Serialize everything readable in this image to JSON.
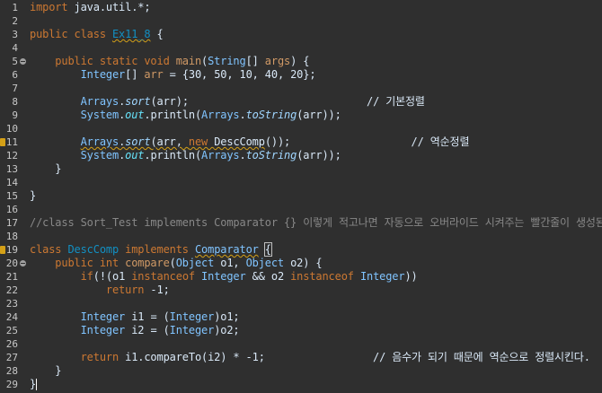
{
  "editor": {
    "lines": [
      {
        "n": "1",
        "tokens": [
          {
            "t": "import",
            "c": "kw"
          },
          {
            "t": " java.util.*;",
            "c": "plain"
          }
        ]
      },
      {
        "n": "2",
        "tokens": []
      },
      {
        "n": "3",
        "tokens": [
          {
            "t": "public class ",
            "c": "kw"
          },
          {
            "t": "Ex11_8",
            "c": "cls warn"
          },
          {
            "t": " {",
            "c": "plain"
          }
        ]
      },
      {
        "n": "4",
        "tokens": []
      },
      {
        "n": "5",
        "fold": true,
        "tokens": [
          {
            "t": "    public static void ",
            "c": "kw"
          },
          {
            "t": "main",
            "c": "fn"
          },
          {
            "t": "(",
            "c": "plain"
          },
          {
            "t": "String",
            "c": "ty"
          },
          {
            "t": "[] ",
            "c": "plain"
          },
          {
            "t": "args",
            "c": "fn"
          },
          {
            "t": ") {",
            "c": "plain"
          }
        ]
      },
      {
        "n": "6",
        "tokens": [
          {
            "t": "        ",
            "c": "plain"
          },
          {
            "t": "Integer",
            "c": "ty"
          },
          {
            "t": "[] ",
            "c": "plain"
          },
          {
            "t": "arr",
            "c": "fn"
          },
          {
            "t": " = {30, 50, 10, 40, 20};",
            "c": "plain"
          }
        ]
      },
      {
        "n": "7",
        "tokens": []
      },
      {
        "n": "8",
        "tokens": [
          {
            "t": "        ",
            "c": "plain"
          },
          {
            "t": "Arrays",
            "c": "ty"
          },
          {
            "t": ".",
            "c": "plain"
          },
          {
            "t": "sort",
            "c": "it"
          },
          {
            "t": "(arr);                            // 기본정렬",
            "c": "plain"
          }
        ]
      },
      {
        "n": "9",
        "tokens": [
          {
            "t": "        ",
            "c": "plain"
          },
          {
            "t": "System",
            "c": "ty"
          },
          {
            "t": ".",
            "c": "plain"
          },
          {
            "t": "out",
            "c": "fi"
          },
          {
            "t": ".println(",
            "c": "plain"
          },
          {
            "t": "Arrays",
            "c": "ty"
          },
          {
            "t": ".",
            "c": "plain"
          },
          {
            "t": "toString",
            "c": "it"
          },
          {
            "t": "(arr));",
            "c": "plain"
          }
        ]
      },
      {
        "n": "10",
        "tokens": []
      },
      {
        "n": "11",
        "marker": true,
        "tokens": [
          {
            "t": "        ",
            "c": "plain"
          },
          {
            "t": "Arrays",
            "c": "ty warn"
          },
          {
            "t": ".",
            "c": "plain warn"
          },
          {
            "t": "sort",
            "c": "it warn"
          },
          {
            "t": "(arr, ",
            "c": "plain warn"
          },
          {
            "t": "new ",
            "c": "kw warn"
          },
          {
            "t": "DescComp",
            "c": "plain warn"
          },
          {
            "t": "());                   // 역순정렬",
            "c": "plain"
          }
        ]
      },
      {
        "n": "12",
        "tokens": [
          {
            "t": "        ",
            "c": "plain"
          },
          {
            "t": "System",
            "c": "ty"
          },
          {
            "t": ".",
            "c": "plain"
          },
          {
            "t": "out",
            "c": "fi"
          },
          {
            "t": ".println(",
            "c": "plain"
          },
          {
            "t": "Arrays",
            "c": "ty"
          },
          {
            "t": ".",
            "c": "plain"
          },
          {
            "t": "toString",
            "c": "it"
          },
          {
            "t": "(arr));",
            "c": "plain"
          }
        ]
      },
      {
        "n": "13",
        "tokens": [
          {
            "t": "    }",
            "c": "plain"
          }
        ]
      },
      {
        "n": "14",
        "tokens": []
      },
      {
        "n": "15",
        "tokens": [
          {
            "t": "}",
            "c": "plain"
          }
        ]
      },
      {
        "n": "16",
        "tokens": []
      },
      {
        "n": "17",
        "tokens": [
          {
            "t": "//class Sort_Test implements Comparator {} 이렇게 적고나면 자동으로 오버라이드 시켜주는 빨간줄이 생성된다.",
            "c": "cm"
          }
        ]
      },
      {
        "n": "18",
        "tokens": []
      },
      {
        "n": "19",
        "marker": true,
        "tokens": [
          {
            "t": "class ",
            "c": "kw"
          },
          {
            "t": "DescComp",
            "c": "cls"
          },
          {
            "t": " implements ",
            "c": "kw"
          },
          {
            "t": "Comparator",
            "c": "ty warn"
          },
          {
            "t": " ",
            "c": "plain"
          },
          {
            "t": "{",
            "c": "plain box"
          }
        ]
      },
      {
        "n": "20",
        "fold": true,
        "tokens": [
          {
            "t": "    public int ",
            "c": "kw"
          },
          {
            "t": "compare",
            "c": "fn"
          },
          {
            "t": "(",
            "c": "plain"
          },
          {
            "t": "Object",
            "c": "ty"
          },
          {
            "t": " o1, ",
            "c": "plain"
          },
          {
            "t": "Object",
            "c": "ty"
          },
          {
            "t": " o2) {",
            "c": "plain"
          }
        ]
      },
      {
        "n": "21",
        "tokens": [
          {
            "t": "        ",
            "c": "plain"
          },
          {
            "t": "if",
            "c": "kw"
          },
          {
            "t": "(!(o1 ",
            "c": "plain"
          },
          {
            "t": "instanceof ",
            "c": "kw"
          },
          {
            "t": "Integer",
            "c": "ty"
          },
          {
            "t": " && o2 ",
            "c": "plain"
          },
          {
            "t": "instanceof ",
            "c": "kw"
          },
          {
            "t": "Integer",
            "c": "ty"
          },
          {
            "t": "))",
            "c": "plain"
          }
        ]
      },
      {
        "n": "22",
        "tokens": [
          {
            "t": "            ",
            "c": "plain"
          },
          {
            "t": "return",
            "c": "kw"
          },
          {
            "t": " -1;",
            "c": "plain"
          }
        ]
      },
      {
        "n": "23",
        "tokens": []
      },
      {
        "n": "24",
        "tokens": [
          {
            "t": "        ",
            "c": "plain"
          },
          {
            "t": "Integer",
            "c": "ty"
          },
          {
            "t": " i1 = (",
            "c": "plain"
          },
          {
            "t": "Integer",
            "c": "ty"
          },
          {
            "t": ")o1;",
            "c": "plain"
          }
        ]
      },
      {
        "n": "25",
        "tokens": [
          {
            "t": "        ",
            "c": "plain"
          },
          {
            "t": "Integer",
            "c": "ty"
          },
          {
            "t": " i2 = (",
            "c": "plain"
          },
          {
            "t": "Integer",
            "c": "ty"
          },
          {
            "t": ")o2;",
            "c": "plain"
          }
        ]
      },
      {
        "n": "26",
        "tokens": []
      },
      {
        "n": "27",
        "tokens": [
          {
            "t": "        ",
            "c": "plain"
          },
          {
            "t": "return",
            "c": "kw"
          },
          {
            "t": " i1.compareTo(i2) * -1;                 // 음수가 되기 때문에 역순으로 정렬시킨다.",
            "c": "plain"
          }
        ]
      },
      {
        "n": "28",
        "tokens": [
          {
            "t": "    }",
            "c": "plain"
          }
        ]
      },
      {
        "n": "29",
        "cursor": true,
        "tokens": [
          {
            "t": "}",
            "c": "plain"
          }
        ]
      }
    ]
  }
}
